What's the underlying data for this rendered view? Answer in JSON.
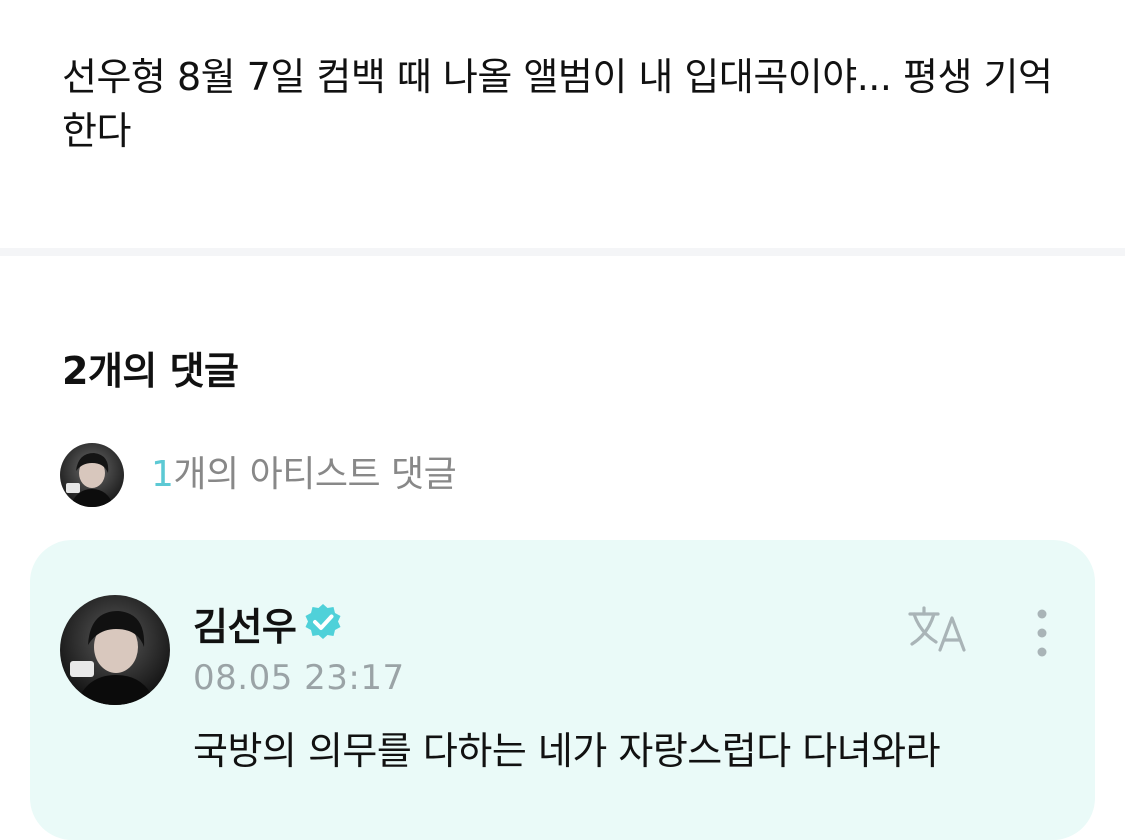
{
  "post": {
    "body": "선우형 8월 7일 컴백 때 나올 앨범이 내 입대곡이야... 평생 기억한다"
  },
  "comments": {
    "heading": "2개의 댓글",
    "artist_summary": {
      "count": "1",
      "label": "개의 아티스트 댓글",
      "avatar_icon": "artist-avatar-icon"
    },
    "items": [
      {
        "author": "김선우",
        "verified": true,
        "timestamp": "08.05 23:17",
        "text": "국방의 의무를 다하는 네가 자랑스럽다 다녀와라",
        "translate_icon": "translate-icon",
        "more_icon": "more-vertical-icon"
      }
    ]
  },
  "colors": {
    "accent": "#5cc9d4",
    "card_background": "#eafaf8",
    "verified_badge": "#4fd1d9",
    "muted_text": "#888888"
  }
}
